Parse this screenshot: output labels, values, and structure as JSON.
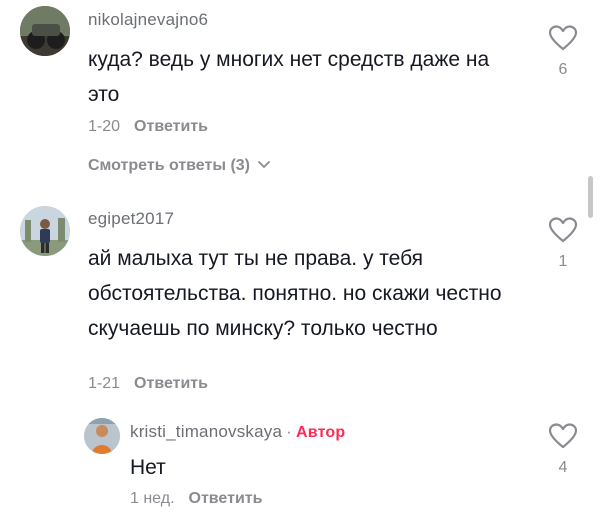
{
  "comments": [
    {
      "username": "nikolajnevajno6",
      "text": "куда? ведь у многих нет средств даже на это",
      "time": "1-20",
      "reply_label": "Ответить",
      "likes": "6",
      "view_replies": "Смотреть ответы (3)"
    },
    {
      "username": "egipet2017",
      "text": "ай малыха тут ты не права. у тебя обстоятельства. понятно. но скажи честно скучаешь по минску? только честно",
      "time": "1-21",
      "reply_label": "Ответить",
      "likes": "1"
    },
    {
      "username": "kristi_timanovskaya",
      "separator": "·",
      "badge": "Автор",
      "text": "Нет",
      "time": "1 нед.",
      "reply_label": "Ответить",
      "likes": "4"
    }
  ],
  "icons": {
    "like": "heart-outline-icon",
    "expand": "chevron-down-icon"
  },
  "colors": {
    "text": "#161823",
    "secondary": "#8a8b91",
    "author_badge": "#fe2c55"
  }
}
